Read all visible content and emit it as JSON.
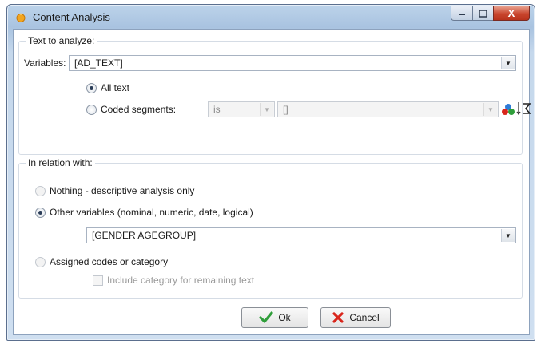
{
  "window": {
    "title": "Content Analysis",
    "close_glyph": "X"
  },
  "text_group": {
    "legend": "Text to analyze:",
    "variables_label": "Variables:",
    "variables_value": "[AD_TEXT]",
    "all_text_label": "All text",
    "all_text_selected": true,
    "coded_segments_label": "Coded segments:",
    "coded_segments_selected": false,
    "operator_value": "is",
    "codes_value": "[]"
  },
  "relation_group": {
    "legend": "In relation with:",
    "nothing_label": "Nothing - descriptive analysis only",
    "other_variables_label": "Other variables (nominal, numeric, date, logical)",
    "other_variables_selected": true,
    "other_variables_value": "[GENDER AGEGROUP]",
    "assigned_codes_label": "Assigned codes or category",
    "include_category_label": "Include category for remaining text"
  },
  "buttons": {
    "ok_label": "Ok",
    "cancel_label": "Cancel"
  },
  "icons": {
    "app": "app-icon",
    "color_codes": "color-codes-icon",
    "sigma_sort": "sigma-sort-icon"
  },
  "colors": {
    "ok_check": "#2f9e3a",
    "cancel_x": "#d9261c"
  }
}
